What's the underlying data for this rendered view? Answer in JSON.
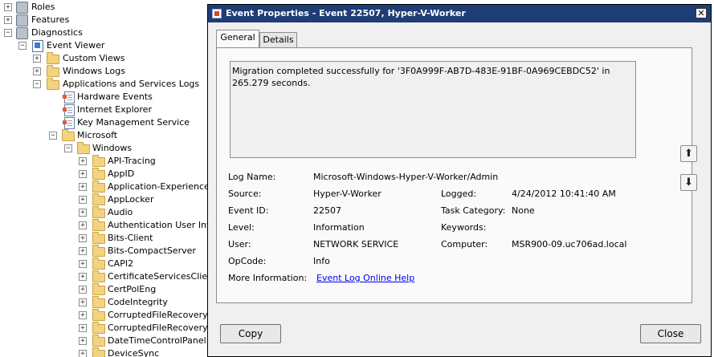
{
  "tree": {
    "roles": "Roles",
    "features": "Features",
    "diagnostics": "Diagnostics",
    "event_viewer": "Event Viewer",
    "custom_views": "Custom Views",
    "windows_logs": "Windows Logs",
    "apps_services_logs": "Applications and Services Logs",
    "hardware_events": "Hardware Events",
    "internet_explorer": "Internet Explorer",
    "key_management": "Key Management Service",
    "microsoft": "Microsoft",
    "windows": "Windows",
    "windows_children": [
      "API-Tracing",
      "AppID",
      "Application-Experience",
      "AppLocker",
      "Audio",
      "Authentication User Inter",
      "Bits-Client",
      "Bits-CompactServer",
      "CAPI2",
      "CertificateServicesClient-",
      "CertPolEng",
      "CodeIntegrity",
      "CorruptedFileRecovery-C",
      "CorruptedFileRecovery-S",
      "DateTimeControlPanel",
      "DeviceSync"
    ]
  },
  "dialog": {
    "title": "Event Properties - Event 22507, Hyper-V-Worker",
    "close_glyph": "✕",
    "tabs": {
      "general": "General",
      "details": "Details"
    },
    "description": "Migration completed successfully for '3F0A999F-AB7D-483E-91BF-0A969CEBDC52' in 265.279 seconds.",
    "fields": {
      "log_name_label": "Log Name:",
      "log_name_value": "Microsoft-Windows-Hyper-V-Worker/Admin",
      "source_label": "Source:",
      "source_value": "Hyper-V-Worker",
      "logged_label": "Logged:",
      "logged_value": "4/24/2012 10:41:40 AM",
      "event_id_label": "Event ID:",
      "event_id_value": "22507",
      "task_category_label": "Task Category:",
      "task_category_value": "None",
      "level_label": "Level:",
      "level_value": "Information",
      "keywords_label": "Keywords:",
      "keywords_value": "",
      "user_label": "User:",
      "user_value": "NETWORK SERVICE",
      "computer_label": "Computer:",
      "computer_value": "MSR900-09.uc706ad.local",
      "opcode_label": "OpCode:",
      "opcode_value": "Info",
      "more_info_label": "More Information:",
      "more_info_link": "Event Log Online Help"
    },
    "buttons": {
      "copy": "Copy",
      "close": "Close",
      "up_glyph": "⬆",
      "down_glyph": "⬇"
    }
  },
  "icons": [
    "expand-icon",
    "collapse-icon",
    "folder-icon",
    "log-icon",
    "gear-icon",
    "event-viewer-icon",
    "up-arrow-icon",
    "down-arrow-icon",
    "close-icon"
  ],
  "colors": {
    "titlebar": "#1f3d75",
    "dialog_bg": "#f0f0f0",
    "folder": "#f3d37d",
    "link": "#0000ee"
  }
}
